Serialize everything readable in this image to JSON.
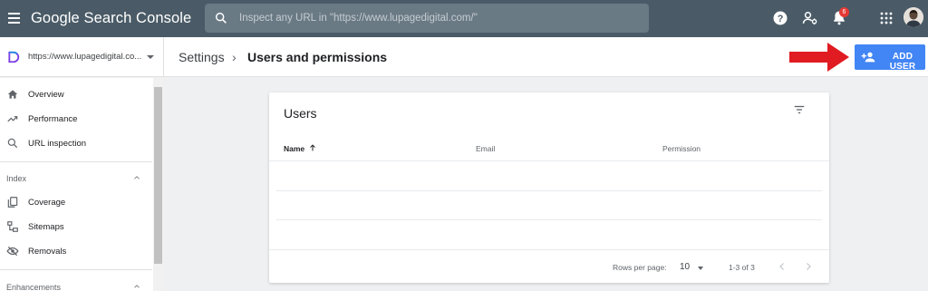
{
  "app": {
    "title": "Google Search Console"
  },
  "search": {
    "placeholder": "Inspect any URL in \"https://www.lupagedigital.com/\""
  },
  "topbar": {
    "notification_count": "6"
  },
  "property": {
    "label": "https://www.lupagedigital.co..."
  },
  "breadcrumb": {
    "parent": "Settings",
    "separator": "›",
    "current": "Users and permissions"
  },
  "actions": {
    "add_user_label": "ADD USER"
  },
  "sidebar": {
    "items": [
      {
        "label": "Overview",
        "icon": "home-icon"
      },
      {
        "label": "Performance",
        "icon": "trending-up-icon"
      },
      {
        "label": "URL inspection",
        "icon": "search-icon"
      }
    ],
    "index_section": {
      "label": "Index",
      "items": [
        {
          "label": "Coverage",
          "icon": "coverage-icon"
        },
        {
          "label": "Sitemaps",
          "icon": "sitemap-icon"
        },
        {
          "label": "Removals",
          "icon": "removals-icon"
        }
      ]
    },
    "enhancements_section": {
      "label": "Enhancements"
    }
  },
  "users_card": {
    "title": "Users",
    "columns": {
      "name": "Name",
      "email": "Email",
      "permission": "Permission"
    },
    "pagination": {
      "rows_per_page_label": "Rows per page:",
      "rows_per_page_value": "10",
      "range": "1-3 of 3"
    }
  },
  "colors": {
    "topbar": "#4a5b67",
    "accent": "#4285f4",
    "arrow": "#e01b22",
    "badge": "#e53935"
  }
}
